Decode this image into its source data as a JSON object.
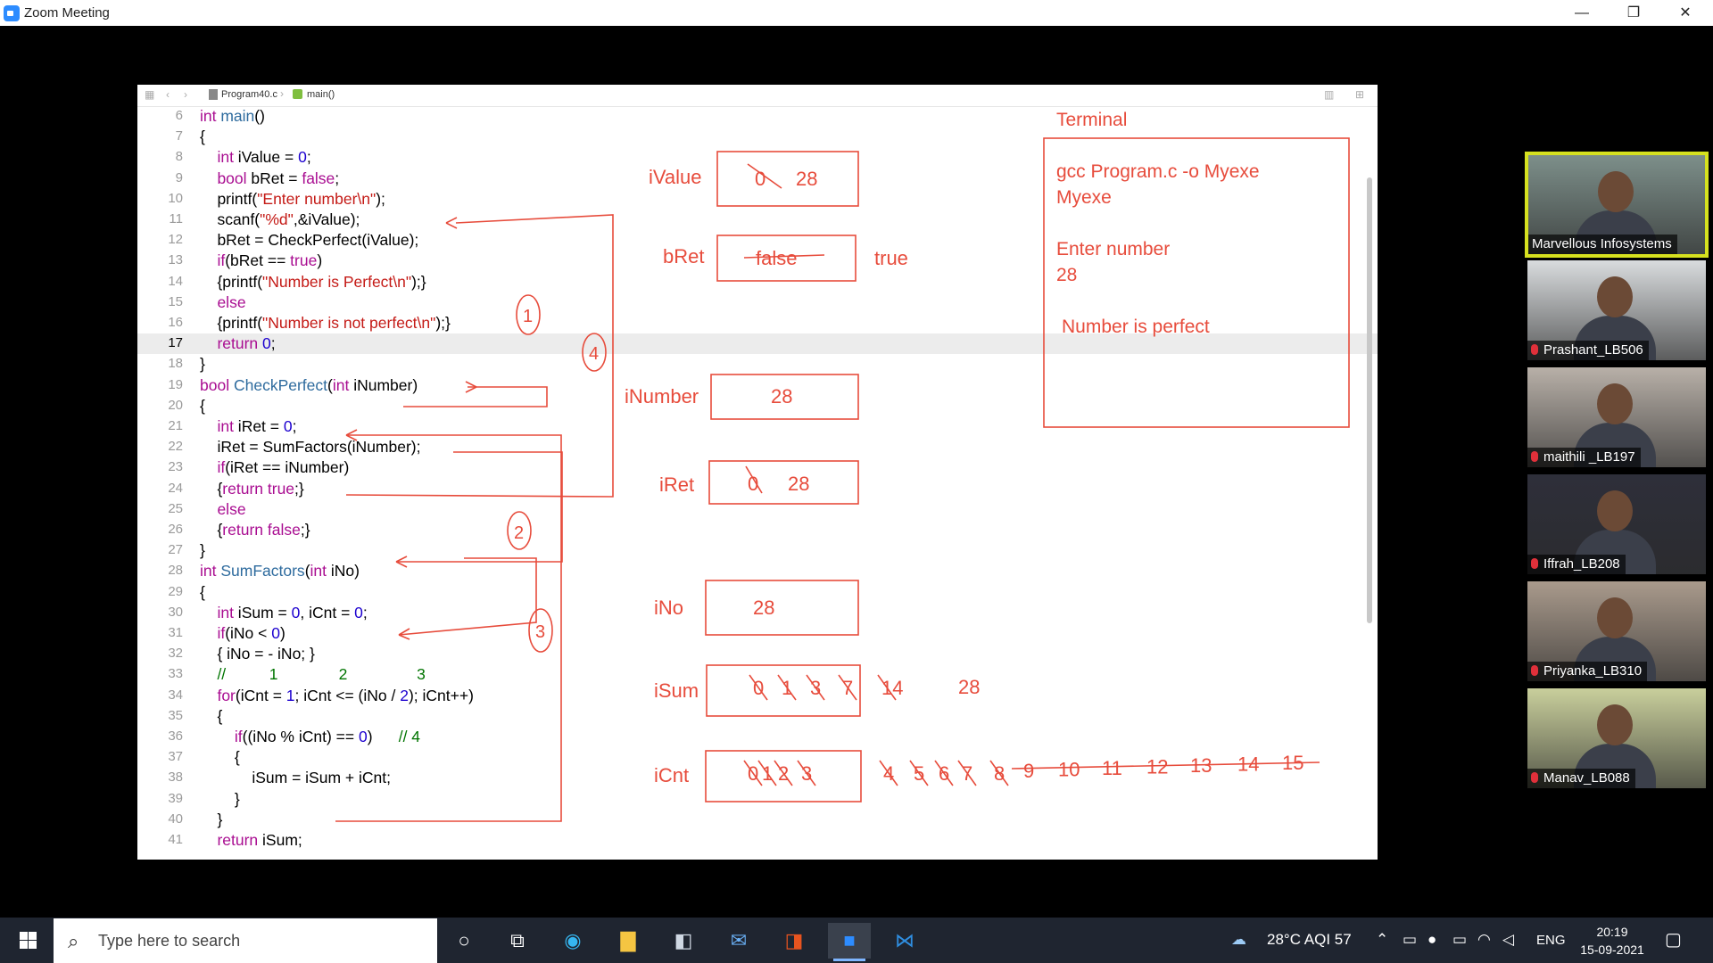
{
  "window": {
    "title": "Zoom Meeting",
    "minimize": "—",
    "maximize": "❐",
    "close": "✕"
  },
  "editor": {
    "breadcrumb": {
      "file": "Program40.c",
      "function": "main()"
    },
    "lines": [
      {
        "n": "6",
        "t": [
          [
            "k",
            "int"
          ],
          [
            "p",
            " "
          ],
          [
            "f",
            "main"
          ],
          [
            "p",
            "()"
          ]
        ]
      },
      {
        "n": "7",
        "t": [
          [
            "p",
            "{"
          ]
        ]
      },
      {
        "n": "8",
        "t": [
          [
            "p",
            "    "
          ],
          [
            "k",
            "int"
          ],
          [
            "p",
            " iValue = "
          ],
          [
            "n",
            "0"
          ],
          [
            "p",
            ";"
          ]
        ]
      },
      {
        "n": "9",
        "t": [
          [
            "p",
            "    "
          ],
          [
            "k",
            "bool"
          ],
          [
            "p",
            " bRet = "
          ],
          [
            "k",
            "false"
          ],
          [
            "p",
            ";"
          ]
        ]
      },
      {
        "n": "10",
        "t": [
          [
            "p",
            "    printf("
          ],
          [
            "s",
            "\"Enter number\\n\""
          ],
          [
            "p",
            ");"
          ]
        ]
      },
      {
        "n": "11",
        "t": [
          [
            "p",
            "    scanf("
          ],
          [
            "s",
            "\"%d\""
          ],
          [
            "p",
            ",&iValue);"
          ]
        ]
      },
      {
        "n": "12",
        "t": [
          [
            "p",
            "    bRet = CheckPerfect(iValue);"
          ]
        ]
      },
      {
        "n": "13",
        "t": [
          [
            "p",
            "    "
          ],
          [
            "k",
            "if"
          ],
          [
            "p",
            "(bRet == "
          ],
          [
            "k",
            "true"
          ],
          [
            "p",
            ")"
          ]
        ]
      },
      {
        "n": "14",
        "t": [
          [
            "p",
            "    {printf("
          ],
          [
            "s",
            "\"Number is Perfect\\n\""
          ],
          [
            "p",
            ");}"
          ]
        ]
      },
      {
        "n": "15",
        "t": [
          [
            "p",
            "    "
          ],
          [
            "k",
            "else"
          ]
        ]
      },
      {
        "n": "16",
        "t": [
          [
            "p",
            "    {printf("
          ],
          [
            "s",
            "\"Number is not perfect\\n\""
          ],
          [
            "p",
            ");}"
          ]
        ]
      },
      {
        "n": "17",
        "t": [
          [
            "p",
            "    "
          ],
          [
            "k",
            "return"
          ],
          [
            "p",
            " "
          ],
          [
            "n",
            "0"
          ],
          [
            "p",
            ";"
          ]
        ]
      },
      {
        "n": "18",
        "t": [
          [
            "p",
            "}"
          ]
        ]
      },
      {
        "n": "19",
        "t": [
          [
            "k",
            "bool"
          ],
          [
            "p",
            " "
          ],
          [
            "f",
            "CheckPerfect"
          ],
          [
            "p",
            "("
          ],
          [
            "k",
            "int"
          ],
          [
            "p",
            " iNumber)"
          ]
        ]
      },
      {
        "n": "20",
        "t": [
          [
            "p",
            "{"
          ]
        ]
      },
      {
        "n": "21",
        "t": [
          [
            "p",
            "    "
          ],
          [
            "k",
            "int"
          ],
          [
            "p",
            " iRet = "
          ],
          [
            "n",
            "0"
          ],
          [
            "p",
            ";"
          ]
        ]
      },
      {
        "n": "22",
        "t": [
          [
            "p",
            "    iRet = SumFactors(iNumber);"
          ]
        ]
      },
      {
        "n": "23",
        "t": [
          [
            "p",
            "    "
          ],
          [
            "k",
            "if"
          ],
          [
            "p",
            "(iRet == iNumber)"
          ]
        ]
      },
      {
        "n": "24",
        "t": [
          [
            "p",
            "    {"
          ],
          [
            "k",
            "return true"
          ],
          [
            "p",
            ";}"
          ]
        ]
      },
      {
        "n": "25",
        "t": [
          [
            "p",
            "    "
          ],
          [
            "k",
            "else"
          ]
        ]
      },
      {
        "n": "26",
        "t": [
          [
            "p",
            "    {"
          ],
          [
            "k",
            "return false"
          ],
          [
            "p",
            ";}"
          ]
        ]
      },
      {
        "n": "27",
        "t": [
          [
            "p",
            "}"
          ]
        ]
      },
      {
        "n": "28",
        "t": [
          [
            "k",
            "int"
          ],
          [
            "p",
            " "
          ],
          [
            "f",
            "SumFactors"
          ],
          [
            "p",
            "("
          ],
          [
            "k",
            "int"
          ],
          [
            "p",
            " iNo)"
          ]
        ]
      },
      {
        "n": "29",
        "t": [
          [
            "p",
            "{"
          ]
        ]
      },
      {
        "n": "30",
        "t": [
          [
            "p",
            "    "
          ],
          [
            "k",
            "int"
          ],
          [
            "p",
            " iSum = "
          ],
          [
            "n",
            "0"
          ],
          [
            "p",
            ", iCnt = "
          ],
          [
            "n",
            "0"
          ],
          [
            "p",
            ";"
          ]
        ]
      },
      {
        "n": "31",
        "t": [
          [
            "p",
            "    "
          ],
          [
            "k",
            "if"
          ],
          [
            "p",
            "(iNo < "
          ],
          [
            "n",
            "0"
          ],
          [
            "p",
            ")"
          ]
        ]
      },
      {
        "n": "32",
        "t": [
          [
            "p",
            "    { iNo = - iNo; }"
          ]
        ]
      },
      {
        "n": "33",
        "t": [
          [
            "c",
            "    //          1              2                3"
          ]
        ]
      },
      {
        "n": "34",
        "t": [
          [
            "p",
            "    "
          ],
          [
            "k",
            "for"
          ],
          [
            "p",
            "(iCnt = "
          ],
          [
            "n",
            "1"
          ],
          [
            "p",
            "; iCnt <= (iNo / "
          ],
          [
            "n",
            "2"
          ],
          [
            "p",
            "); iCnt++)"
          ]
        ]
      },
      {
        "n": "35",
        "t": [
          [
            "p",
            "    {"
          ]
        ]
      },
      {
        "n": "36",
        "t": [
          [
            "p",
            "        "
          ],
          [
            "k",
            "if"
          ],
          [
            "p",
            "((iNo % iCnt) == "
          ],
          [
            "n",
            "0"
          ],
          [
            "p",
            ")      "
          ],
          [
            "c",
            "// 4"
          ]
        ]
      },
      {
        "n": "37",
        "t": [
          [
            "p",
            "        {"
          ]
        ]
      },
      {
        "n": "38",
        "t": [
          [
            "p",
            "            iSum = iSum + iCnt;"
          ]
        ]
      },
      {
        "n": "39",
        "t": [
          [
            "p",
            "        }"
          ]
        ]
      },
      {
        "n": "40",
        "t": [
          [
            "p",
            "    }"
          ]
        ]
      },
      {
        "n": "41",
        "t": [
          [
            "p",
            "    "
          ],
          [
            "k",
            "return"
          ],
          [
            "p",
            " iSum;"
          ]
        ]
      }
    ],
    "highlight_line": "17"
  },
  "annotations": {
    "vars": {
      "ivalue": {
        "label": "iValue",
        "old": "0",
        "val": "28"
      },
      "bret": {
        "label": "bRet",
        "old": "false",
        "val": "true"
      },
      "inumber": {
        "label": "iNumber",
        "val": "28"
      },
      "iret": {
        "label": "iRet",
        "old": "0",
        "val": "28"
      },
      "ino": {
        "label": "iNo",
        "val": "28"
      },
      "isum": {
        "label": "iSum",
        "struck": [
          "0",
          "1",
          "3",
          "7",
          "14"
        ],
        "val": "28"
      },
      "icnt": {
        "label": "iCnt",
        "struck": [
          "0",
          "1",
          "2",
          "3",
          "4",
          "5",
          "6",
          "7",
          "8"
        ],
        "line": [
          "9",
          "10",
          "11",
          "12",
          "13",
          "14",
          "15"
        ]
      }
    },
    "steps": [
      "1",
      "2",
      "3",
      "4"
    ],
    "terminal": {
      "title": "Terminal",
      "lines": [
        "gcc Program.c -o Myexe",
        "Myexe",
        "",
        "Enter number",
        "28",
        "",
        "Number is perfect"
      ]
    },
    "colors": {
      "ink": "#e74c3c"
    }
  },
  "participants": [
    {
      "name": "Marvellous Infosystems",
      "active": true,
      "muted": false,
      "bg": "#7d8f8a"
    },
    {
      "name": "Prashant_LB506",
      "active": false,
      "muted": true,
      "bg": "#d9dcde"
    },
    {
      "name": "maithili _LB197",
      "active": false,
      "muted": true,
      "bg": "#b8b0a8"
    },
    {
      "name": "Iffrah_LB208",
      "active": false,
      "muted": true,
      "bg": "#2e2f3a"
    },
    {
      "name": "Priyanka_LB310",
      "active": false,
      "muted": true,
      "bg": "#a99a8c"
    },
    {
      "name": "Manav_LB088",
      "active": false,
      "muted": true,
      "bg": "#c9cf9c"
    }
  ],
  "taskbar": {
    "search_placeholder": "Type here to search",
    "weather": "28°C  AQI 57",
    "language": "ENG",
    "time": "20:19",
    "date": "15-09-2021"
  }
}
